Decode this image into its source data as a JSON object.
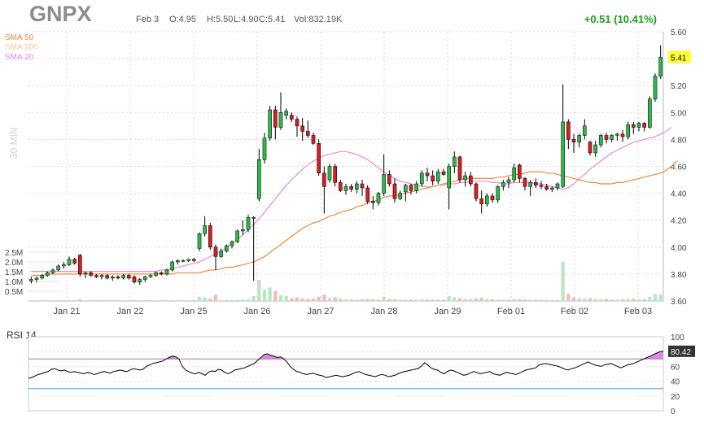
{
  "header": {
    "ticker": "GNPX",
    "date": "Feb 3",
    "open": "O:4.95",
    "high": "H:5.50",
    "low": "L:4.90",
    "close": "C:5.41",
    "volume": "Vol:832.19K",
    "change": "+0.51 (10.41%)"
  },
  "legend": {
    "sma50": "SMA 50",
    "sma200": "SMA 200",
    "sma20": "SMA 20"
  },
  "timeframe_label": "30 MIN",
  "colors": {
    "up": "#2db84b",
    "down": "#d31f26",
    "sma50": "#f08a3c",
    "sma200": "#f5c89a",
    "sma20": "#e88ad8",
    "rsi_line": "#000000",
    "rsi_fill": "#d98ae2",
    "rsi_upper": "#b36ab8",
    "rsi_lower": "#4aa3df",
    "last_price_bg": "#ffff33"
  },
  "chart_data": [
    {
      "type": "candlestick",
      "title": "GNPX",
      "x": [
        "Jan 21",
        "Jan 22",
        "Jan 25",
        "Jan 26",
        "Jan 27",
        "Jan 28",
        "Jan 29",
        "Feb 01",
        "Feb 02",
        "Feb 03"
      ],
      "y_ticks": [
        "5.60",
        "5.40",
        "5.20",
        "5.00",
        "4.80",
        "4.60",
        "4.40",
        "4.20",
        "4.00",
        "3.80",
        "3.60"
      ],
      "ylim": [
        3.6,
        5.6
      ],
      "volume_ticks": [
        "2.5M",
        "2.0M",
        "1.5M",
        "1.0M",
        "0.5M"
      ],
      "last_price": "5.41",
      "candles": [
        [
          3.75,
          3.78,
          3.73,
          3.76
        ],
        [
          3.76,
          3.78,
          3.74,
          3.77
        ],
        [
          3.77,
          3.8,
          3.76,
          3.79
        ],
        [
          3.79,
          3.82,
          3.78,
          3.81
        ],
        [
          3.81,
          3.84,
          3.8,
          3.83
        ],
        [
          3.83,
          3.87,
          3.82,
          3.86
        ],
        [
          3.86,
          3.89,
          3.84,
          3.87
        ],
        [
          3.87,
          3.93,
          3.86,
          3.91
        ],
        [
          3.91,
          3.92,
          3.87,
          3.88
        ],
        [
          3.94,
          3.95,
          3.78,
          3.8
        ],
        [
          3.8,
          3.82,
          3.77,
          3.81
        ],
        [
          3.81,
          3.82,
          3.78,
          3.79
        ],
        [
          3.79,
          3.8,
          3.77,
          3.78
        ],
        [
          3.78,
          3.8,
          3.76,
          3.79
        ],
        [
          3.79,
          3.8,
          3.76,
          3.77
        ],
        [
          3.77,
          3.79,
          3.75,
          3.78
        ],
        [
          3.78,
          3.79,
          3.76,
          3.77
        ],
        [
          3.77,
          3.8,
          3.76,
          3.79
        ],
        [
          3.79,
          3.8,
          3.76,
          3.77
        ],
        [
          3.78,
          3.79,
          3.73,
          3.74
        ],
        [
          3.74,
          3.77,
          3.72,
          3.76
        ],
        [
          3.76,
          3.79,
          3.74,
          3.78
        ],
        [
          3.78,
          3.8,
          3.77,
          3.79
        ],
        [
          3.79,
          3.82,
          3.78,
          3.81
        ],
        [
          3.81,
          3.82,
          3.79,
          3.8
        ],
        [
          3.8,
          3.84,
          3.79,
          3.83
        ],
        [
          3.83,
          3.9,
          3.82,
          3.89
        ],
        [
          3.89,
          3.91,
          3.87,
          3.9
        ],
        [
          3.9,
          3.91,
          3.89,
          3.9
        ],
        [
          3.9,
          3.91,
          3.89,
          3.91
        ],
        [
          3.91,
          3.92,
          3.89,
          3.9
        ],
        [
          3.99,
          4.11,
          3.97,
          4.1
        ],
        [
          4.1,
          4.23,
          4.08,
          4.16
        ],
        [
          4.16,
          4.18,
          3.98,
          4.0
        ],
        [
          4.0,
          4.02,
          3.83,
          3.93
        ],
        [
          3.93,
          3.99,
          3.92,
          3.97
        ],
        [
          3.97,
          4.02,
          3.96,
          4.01
        ],
        [
          4.01,
          4.05,
          3.99,
          4.04
        ],
        [
          4.04,
          4.13,
          4.03,
          4.12
        ],
        [
          4.12,
          4.2,
          4.09,
          4.13
        ],
        [
          4.13,
          4.24,
          4.11,
          4.22
        ],
        [
          4.22,
          4.23,
          3.75,
          4.22
        ],
        [
          4.36,
          4.73,
          4.34,
          4.65
        ],
        [
          4.65,
          4.85,
          4.62,
          4.81
        ],
        [
          4.81,
          5.05,
          4.79,
          5.02
        ],
        [
          5.02,
          5.05,
          4.8,
          4.89
        ],
        [
          4.89,
          5.15,
          4.87,
          5.0
        ],
        [
          4.98,
          5.03,
          4.95,
          5.01
        ],
        [
          4.98,
          5.0,
          4.93,
          4.95
        ],
        [
          4.95,
          4.97,
          4.82,
          4.9
        ],
        [
          4.9,
          4.96,
          4.79,
          4.86
        ],
        [
          4.86,
          4.94,
          4.81,
          4.83
        ],
        [
          4.83,
          4.85,
          4.76,
          4.77
        ],
        [
          4.77,
          4.8,
          4.53,
          4.55
        ],
        [
          4.55,
          4.6,
          4.25,
          4.45
        ],
        [
          4.5,
          4.62,
          4.48,
          4.6
        ],
        [
          4.6,
          4.62,
          4.45,
          4.48
        ],
        [
          4.48,
          4.5,
          4.41,
          4.42
        ],
        [
          4.42,
          4.47,
          4.39,
          4.45
        ],
        [
          4.45,
          4.47,
          4.41,
          4.43
        ],
        [
          4.43,
          4.49,
          4.4,
          4.47
        ],
        [
          4.47,
          4.5,
          4.38,
          4.44
        ],
        [
          4.44,
          4.46,
          4.32,
          4.34
        ],
        [
          4.34,
          4.38,
          4.28,
          4.33
        ],
        [
          4.33,
          4.41,
          4.31,
          4.4
        ],
        [
          4.4,
          4.69,
          4.38,
          4.54
        ],
        [
          4.54,
          4.57,
          4.45,
          4.47
        ],
        [
          4.47,
          4.51,
          4.33,
          4.36
        ],
        [
          4.36,
          4.42,
          4.35,
          4.4
        ],
        [
          4.41,
          4.47,
          4.34,
          4.46
        ],
        [
          4.46,
          4.47,
          4.39,
          4.42
        ],
        [
          4.42,
          4.49,
          4.4,
          4.47
        ],
        [
          4.47,
          4.57,
          4.45,
          4.55
        ],
        [
          4.55,
          4.59,
          4.49,
          4.53
        ],
        [
          4.53,
          4.57,
          4.46,
          4.49
        ],
        [
          4.49,
          4.58,
          4.47,
          4.56
        ],
        [
          4.56,
          4.58,
          4.53,
          4.54
        ],
        [
          4.44,
          4.62,
          4.28,
          4.6
        ],
        [
          4.6,
          4.71,
          4.55,
          4.67
        ],
        [
          4.67,
          4.68,
          4.48,
          4.5
        ],
        [
          4.5,
          4.56,
          4.45,
          4.53
        ],
        [
          4.53,
          4.56,
          4.45,
          4.47
        ],
        [
          4.47,
          4.48,
          4.34,
          4.36
        ],
        [
          4.36,
          4.42,
          4.25,
          4.32
        ],
        [
          4.32,
          4.4,
          4.3,
          4.38
        ],
        [
          4.38,
          4.4,
          4.33,
          4.35
        ],
        [
          4.35,
          4.46,
          4.33,
          4.45
        ],
        [
          4.45,
          4.5,
          4.42,
          4.48
        ],
        [
          4.48,
          4.52,
          4.44,
          4.5
        ],
        [
          4.5,
          4.62,
          4.48,
          4.59
        ],
        [
          4.61,
          4.62,
          4.48,
          4.51
        ],
        [
          4.51,
          4.52,
          4.42,
          4.45
        ],
        [
          4.45,
          4.5,
          4.38,
          4.48
        ],
        [
          4.48,
          4.51,
          4.44,
          4.46
        ],
        [
          4.46,
          4.49,
          4.43,
          4.45
        ],
        [
          4.45,
          4.47,
          4.42,
          4.43
        ],
        [
          4.43,
          4.45,
          4.41,
          4.44
        ],
        [
          4.44,
          4.48,
          4.42,
          4.47
        ],
        [
          4.45,
          5.21,
          4.44,
          4.93
        ],
        [
          4.93,
          4.95,
          4.73,
          4.8
        ],
        [
          4.8,
          4.84,
          4.7,
          4.78
        ],
        [
          4.78,
          4.84,
          4.74,
          4.83
        ],
        [
          4.83,
          4.95,
          4.8,
          4.9
        ],
        [
          4.78,
          4.79,
          4.68,
          4.7
        ],
        [
          4.7,
          4.79,
          4.67,
          4.76
        ],
        [
          4.76,
          4.84,
          4.74,
          4.83
        ],
        [
          4.83,
          4.85,
          4.77,
          4.8
        ],
        [
          4.8,
          4.84,
          4.78,
          4.83
        ],
        [
          4.83,
          4.85,
          4.79,
          4.84
        ],
        [
          4.84,
          4.87,
          4.78,
          4.82
        ],
        [
          4.82,
          4.93,
          4.8,
          4.91
        ],
        [
          4.91,
          4.93,
          4.84,
          4.89
        ],
        [
          4.89,
          4.93,
          4.86,
          4.92
        ],
        [
          4.92,
          4.93,
          4.86,
          4.89
        ],
        [
          4.89,
          5.12,
          4.88,
          5.1
        ],
        [
          5.1,
          5.29,
          5.08,
          5.27
        ],
        [
          5.27,
          5.5,
          5.25,
          5.41
        ]
      ],
      "volumes": [
        0.05,
        0.04,
        0.05,
        0.04,
        0.06,
        0.05,
        0.07,
        0.06,
        0.05,
        0.12,
        0.05,
        0.04,
        0.05,
        0.04,
        0.04,
        0.05,
        0.04,
        0.04,
        0.05,
        0.06,
        0.05,
        0.04,
        0.04,
        0.05,
        0.04,
        0.05,
        0.06,
        0.05,
        0.04,
        0.04,
        0.05,
        0.3,
        0.25,
        0.18,
        0.45,
        0.08,
        0.07,
        0.06,
        0.08,
        0.1,
        0.12,
        0.35,
        1.5,
        0.8,
        0.95,
        0.7,
        0.4,
        0.35,
        0.2,
        0.25,
        0.18,
        0.15,
        0.18,
        0.3,
        0.45,
        0.2,
        0.25,
        0.15,
        0.12,
        0.1,
        0.1,
        0.12,
        0.14,
        0.12,
        0.1,
        0.3,
        0.15,
        0.12,
        0.1,
        0.1,
        0.09,
        0.1,
        0.12,
        0.1,
        0.09,
        0.1,
        0.08,
        0.35,
        0.25,
        0.2,
        0.15,
        0.12,
        0.18,
        0.22,
        0.15,
        0.12,
        0.1,
        0.1,
        0.12,
        0.15,
        0.12,
        0.1,
        0.09,
        0.08,
        0.08,
        0.07,
        0.07,
        0.08,
        2.8,
        0.5,
        0.25,
        0.2,
        0.18,
        0.2,
        0.15,
        0.12,
        0.15,
        0.12,
        0.1,
        0.12,
        0.14,
        0.15,
        0.12,
        0.13,
        0.3,
        0.5,
        0.45
      ],
      "volume_max": 10.0,
      "sma50": [
        3.79,
        3.79,
        3.79,
        3.8,
        3.8,
        3.8,
        3.8,
        3.8,
        3.8,
        3.8,
        3.8,
        3.8,
        3.8,
        3.8,
        3.8,
        3.8,
        3.8,
        3.8,
        3.8,
        3.8,
        3.8,
        3.8,
        3.8,
        3.8,
        3.8,
        3.8,
        3.8,
        3.81,
        3.81,
        3.81,
        3.81,
        3.81,
        3.82,
        3.83,
        3.83,
        3.84,
        3.85,
        3.85,
        3.86,
        3.87,
        3.88,
        3.89,
        3.91,
        3.93,
        3.96,
        3.99,
        4.02,
        4.05,
        4.08,
        4.11,
        4.14,
        4.16,
        4.18,
        4.19,
        4.21,
        4.23,
        4.24,
        4.26,
        4.27,
        4.28,
        4.3,
        4.31,
        4.33,
        4.34,
        4.35,
        4.37,
        4.38,
        4.38,
        4.39,
        4.4,
        4.41,
        4.42,
        4.43,
        4.44,
        4.45,
        4.46,
        4.47,
        4.48,
        4.49,
        4.5,
        4.51,
        4.51,
        4.51,
        4.51,
        4.51,
        4.51,
        4.52,
        4.52,
        4.53,
        4.54,
        4.54,
        4.55,
        4.56,
        4.56,
        4.56,
        4.55,
        4.55,
        4.54,
        4.53,
        4.52,
        4.51,
        4.5,
        4.49,
        4.48,
        4.48,
        4.47,
        4.47,
        4.47,
        4.48,
        4.48,
        4.49,
        4.5,
        4.51,
        4.52,
        4.53,
        4.54,
        4.55,
        4.57,
        4.6,
        4.64
      ],
      "sma20": [
        3.82,
        3.82,
        3.82,
        3.82,
        3.82,
        3.82,
        3.82,
        3.82,
        3.82,
        3.82,
        3.82,
        3.82,
        3.82,
        3.82,
        3.82,
        3.82,
        3.82,
        3.82,
        3.82,
        3.82,
        3.82,
        3.82,
        3.82,
        3.82,
        3.83,
        3.83,
        3.84,
        3.85,
        3.86,
        3.87,
        3.88,
        3.89,
        3.91,
        3.93,
        3.95,
        3.97,
        4.0,
        4.03,
        4.06,
        4.09,
        4.13,
        4.17,
        4.21,
        4.26,
        4.31,
        4.36,
        4.41,
        4.46,
        4.5,
        4.54,
        4.58,
        4.61,
        4.64,
        4.66,
        4.68,
        4.69,
        4.7,
        4.71,
        4.71,
        4.7,
        4.69,
        4.67,
        4.65,
        4.62,
        4.59,
        4.56,
        4.53,
        4.51,
        4.49,
        4.48,
        4.47,
        4.46,
        4.45,
        4.45,
        4.45,
        4.46,
        4.46,
        4.47,
        4.47,
        4.48,
        4.48,
        4.49,
        4.49,
        4.49,
        4.49,
        4.48,
        4.48,
        4.47,
        4.47,
        4.48,
        4.48,
        4.48,
        4.48,
        4.47,
        4.47,
        4.46,
        4.45,
        4.44,
        4.43,
        4.44,
        4.47,
        4.51,
        4.54,
        4.58,
        4.61,
        4.64,
        4.67,
        4.7,
        4.72,
        4.74,
        4.76,
        4.78,
        4.79,
        4.8,
        4.81,
        4.82,
        4.84,
        4.86,
        4.89
      ],
      "sma200": []
    },
    {
      "type": "line",
      "title": "RSI 14",
      "y_ticks": [
        "100",
        "80",
        "60",
        "40",
        "20",
        "0"
      ],
      "ylim": [
        0,
        100
      ],
      "overbought": 70,
      "oversold": 30,
      "last_value": "80.42",
      "values": [
        44,
        45,
        47,
        49,
        50,
        52,
        53,
        56,
        57,
        55,
        54,
        55,
        53,
        52,
        53,
        52,
        51,
        50,
        52,
        51,
        49,
        50,
        52,
        53,
        52,
        51,
        53,
        54,
        55,
        54,
        53,
        55,
        57,
        56,
        55,
        56,
        60,
        62,
        64,
        65,
        66,
        67,
        70,
        72,
        74,
        73,
        70,
        60,
        55,
        53,
        51,
        50,
        52,
        50,
        48,
        52,
        54,
        53,
        56,
        55,
        52,
        50,
        52,
        55,
        56,
        57,
        58,
        60,
        62,
        64,
        68,
        72,
        76,
        77,
        75,
        74,
        72,
        73,
        70,
        66,
        60,
        56,
        53,
        52,
        50,
        49,
        50,
        51,
        49,
        48,
        47,
        45,
        46,
        47,
        48,
        47,
        46,
        47,
        48,
        50,
        52,
        53,
        51,
        49,
        48,
        47,
        46,
        48,
        49,
        48,
        46,
        47,
        48,
        50,
        52,
        53,
        54,
        55,
        56,
        57,
        60,
        65,
        62,
        58,
        56,
        55,
        52,
        50,
        53,
        55,
        54,
        52,
        50,
        48,
        49,
        51,
        53,
        52,
        50,
        51,
        52,
        53,
        50,
        49,
        48,
        50,
        52,
        51,
        50,
        49,
        51,
        53,
        55,
        56,
        57,
        58,
        62,
        63,
        64,
        63,
        62,
        61,
        60,
        58,
        56,
        55,
        57,
        58,
        60,
        62,
        64,
        66,
        64,
        62,
        61,
        60,
        62,
        63,
        64,
        62,
        60,
        58,
        60,
        62,
        63,
        64,
        66,
        68,
        70,
        72,
        74,
        76,
        78,
        80,
        80.42
      ]
    }
  ]
}
